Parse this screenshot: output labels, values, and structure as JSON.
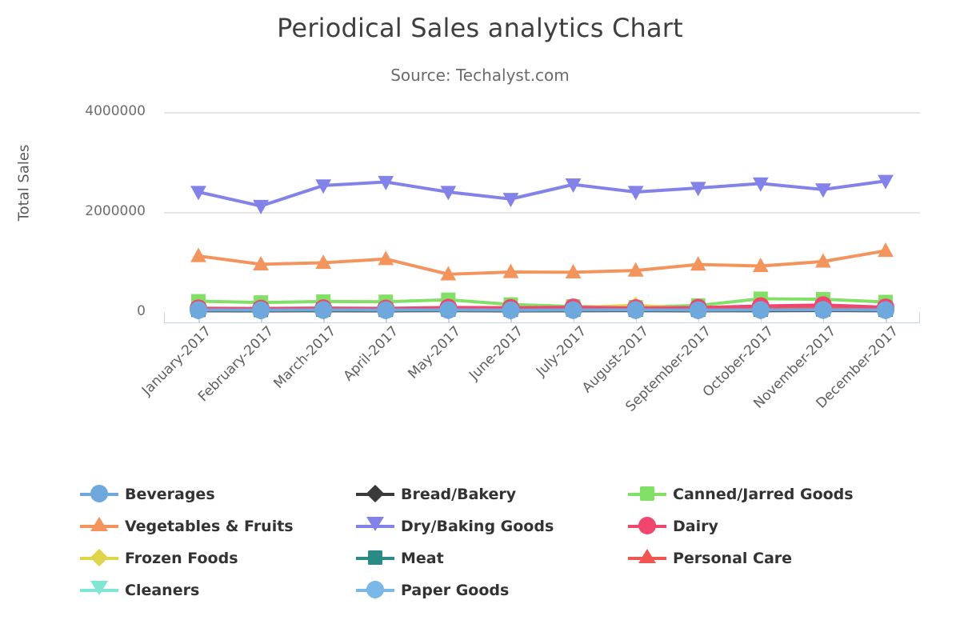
{
  "chart_data": {
    "type": "line",
    "title": "Periodical Sales analytics Chart",
    "subtitle": "Source: Techalyst.com",
    "xlabel": "",
    "ylabel": "Total Sales",
    "ylim": [
      -150000,
      4000000
    ],
    "yticks": [
      0,
      2000000,
      4000000
    ],
    "ytick_labels": [
      "0",
      "2000000",
      "4000000"
    ],
    "grid": true,
    "legend_position": "bottom",
    "legend_columns": 3,
    "categories": [
      "January-2017",
      "February-2017",
      "March-2017",
      "April-2017",
      "May-2017",
      "June-2017",
      "July-2017",
      "August-2017",
      "September-2017",
      "October-2017",
      "November-2017",
      "December-2017"
    ],
    "series": [
      {
        "name": "Beverages",
        "color": "#6fa8dc",
        "marker": "circle",
        "values": [
          40000,
          38000,
          42000,
          39000,
          41000,
          37000,
          40000,
          43000,
          38000,
          42000,
          44000,
          40000
        ]
      },
      {
        "name": "Bread/Bakery",
        "color": "#3a3a3a",
        "marker": "diamond",
        "values": [
          26000,
          24000,
          27000,
          25000,
          28000,
          23000,
          26000,
          29000,
          25000,
          27000,
          30000,
          26000
        ]
      },
      {
        "name": "Canned/Jarred Goods",
        "color": "#82e066",
        "marker": "square",
        "values": [
          215000,
          190000,
          210000,
          205000,
          245000,
          150000,
          110000,
          95000,
          130000,
          265000,
          255000,
          200000
        ]
      },
      {
        "name": "Vegetables & Fruits",
        "color": "#f3945c",
        "marker": "triangle-up",
        "values": [
          1120000,
          955000,
          985000,
          1060000,
          755000,
          800000,
          795000,
          830000,
          950000,
          920000,
          1010000,
          1225000
        ]
      },
      {
        "name": "Dry/Baking Goods",
        "color": "#8282e8",
        "marker": "triangle-down",
        "values": [
          2400000,
          2120000,
          2530000,
          2600000,
          2400000,
          2260000,
          2550000,
          2400000,
          2480000,
          2570000,
          2450000,
          2620000
        ]
      },
      {
        "name": "Dairy",
        "color": "#f0466e",
        "marker": "circle",
        "values": [
          75000,
          70000,
          78000,
          72000,
          90000,
          85000,
          95000,
          80000,
          88000,
          120000,
          140000,
          95000
        ]
      },
      {
        "name": "Frozen Foods",
        "color": "#e0d44a",
        "marker": "diamond",
        "values": [
          55000,
          50000,
          58000,
          54000,
          62000,
          70000,
          85000,
          135000,
          60000,
          58000,
          65000,
          60000
        ]
      },
      {
        "name": "Meat",
        "color": "#2a8a85",
        "marker": "square",
        "values": [
          45000,
          42000,
          47000,
          44000,
          49000,
          46000,
          50000,
          47000,
          45000,
          48000,
          52000,
          46000
        ]
      },
      {
        "name": "Personal Care",
        "color": "#f0564f",
        "marker": "triangle-up",
        "values": [
          60000,
          58000,
          62000,
          59000,
          64000,
          61000,
          66000,
          63000,
          60000,
          65000,
          110000,
          62000
        ]
      },
      {
        "name": "Cleaners",
        "color": "#7fe6d4",
        "marker": "triangle-down",
        "values": [
          30000,
          28000,
          32000,
          29000,
          34000,
          31000,
          35000,
          33000,
          30000,
          34000,
          36000,
          32000
        ]
      },
      {
        "name": "Paper Goods",
        "color": "#7ab8e8",
        "marker": "circle",
        "values": [
          35000,
          33000,
          37000,
          34000,
          38000,
          36000,
          39000,
          37000,
          35000,
          38000,
          40000,
          36000
        ]
      }
    ]
  },
  "legend": {
    "items": [
      {
        "label": "Beverages",
        "color": "#6fa8dc",
        "marker": "circle"
      },
      {
        "label": "Bread/Bakery",
        "color": "#3a3a3a",
        "marker": "diamond"
      },
      {
        "label": "Canned/Jarred Goods",
        "color": "#82e066",
        "marker": "square"
      },
      {
        "label": "Vegetables & Fruits",
        "color": "#f3945c",
        "marker": "triangle-up"
      },
      {
        "label": "Dry/Baking Goods",
        "color": "#8282e8",
        "marker": "triangle-down"
      },
      {
        "label": "Dairy",
        "color": "#f0466e",
        "marker": "circle"
      },
      {
        "label": "Frozen Foods",
        "color": "#e0d44a",
        "marker": "diamond"
      },
      {
        "label": "Meat",
        "color": "#2a8a85",
        "marker": "square"
      },
      {
        "label": "Personal Care",
        "color": "#f0564f",
        "marker": "triangle-up"
      },
      {
        "label": "Cleaners",
        "color": "#7fe6d4",
        "marker": "triangle-down"
      },
      {
        "label": "Paper Goods",
        "color": "#7ab8e8",
        "marker": "circle"
      }
    ]
  },
  "colors": {
    "title": "#3f3f3f",
    "subtitle": "#6b6b6b",
    "grid": "#e6e6e6",
    "axis": "#c5d7ea",
    "tick_text": "#5f5f5f",
    "background": "#ffffff"
  }
}
